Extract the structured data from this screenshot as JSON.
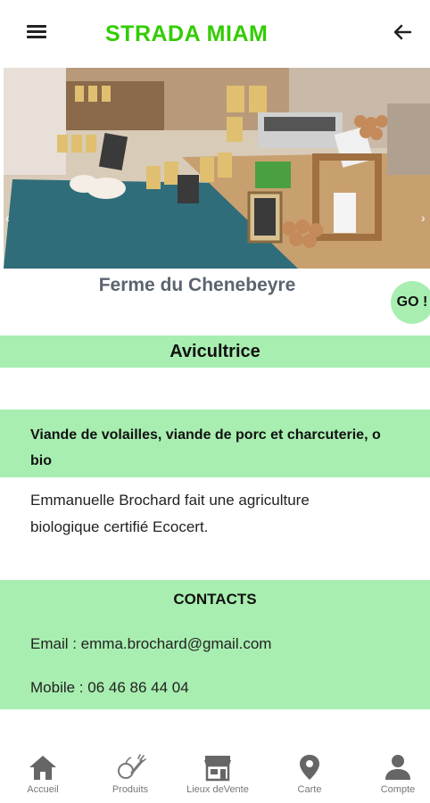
{
  "header": {
    "title": "STRADA MIAM",
    "menu_icon": "hamburger-icon",
    "back_icon": "arrow-left-icon",
    "title_color": "#33cc00"
  },
  "hero": {
    "prev_arrow": "‹",
    "next_arrow": "›"
  },
  "producer": {
    "name": "Ferme du Chenebeyre",
    "go_label": "GO !",
    "role": "Avicultrice",
    "products": "Viande de volailles, viande de porc et charcuterie, o",
    "products_cont": "bio",
    "description_line1": "Emmanuelle Brochard fait une agriculture",
    "description_line2": "biologique certifié Ecocert."
  },
  "contacts": {
    "title": "CONTACTS",
    "email": "Email : emma.brochard@gmail.com",
    "mobile": "Mobile : 06 46 86 44 04"
  },
  "nav": {
    "items": [
      {
        "label": "Accueil",
        "icon": "home-icon"
      },
      {
        "label": "Produits",
        "icon": "produce-icon"
      },
      {
        "label": "Lieux deVente",
        "icon": "store-icon"
      },
      {
        "label": "Carte",
        "icon": "map-pin-icon"
      },
      {
        "label": "Compte",
        "icon": "account-icon"
      }
    ]
  },
  "colors": {
    "accent_green": "#a8eeb0",
    "brand_green": "#33cc00",
    "nav_icon_gray": "#666666"
  }
}
